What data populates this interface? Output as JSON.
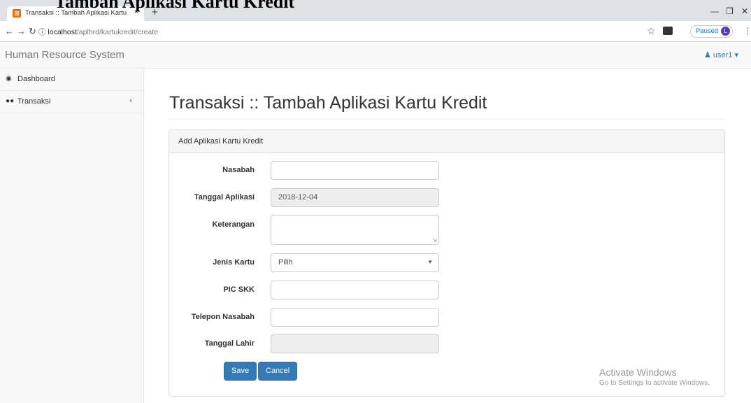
{
  "overlay_title": "Tambah Aplikasi Kartu Kredit",
  "browser": {
    "tab_title": "Transaksi :: Tambah Aplikasi Kartu",
    "tab_close": "×",
    "new_tab": "+",
    "url_host": "localhost",
    "url_path": "/aplhrd/kartukredit/create",
    "profile_status": "Paused",
    "profile_initial": "L"
  },
  "navbar": {
    "brand": "Human Resource System",
    "user": "user1"
  },
  "sidebar": {
    "items": [
      {
        "label": "Dashboard",
        "icon": "dashboard-icon"
      },
      {
        "label": "Transaksi",
        "icon": "users-icon",
        "chevron": "‹"
      }
    ]
  },
  "main": {
    "page_title": "Transaksi :: Tambah Aplikasi Kartu Kredit",
    "panel_heading": "Add Aplikasi Kartu Kredit",
    "fields": {
      "nasabah": {
        "label": "Nasabah",
        "value": ""
      },
      "tanggal_aplikasi": {
        "label": "Tanggal Aplikasi",
        "value": "2018-12-04"
      },
      "keterangan": {
        "label": "Keterangan",
        "value": ""
      },
      "jenis_kartu": {
        "label": "Jenis Kartu",
        "selected": "Pilih"
      },
      "pic_skk": {
        "label": "PIC SKK",
        "value": ""
      },
      "telepon_nasabah": {
        "label": "Telepon Nasabah",
        "value": ""
      },
      "tanggal_lahir": {
        "label": "Tanggal Lahir",
        "value": ""
      }
    },
    "save_label": "Save",
    "cancel_label": "Cancel"
  },
  "watermark": {
    "line1": "Activate Windows",
    "line2": "Go to Settings to activate Windows."
  },
  "colors": {
    "primary": "#337ab7",
    "navbar_bg": "#f8f8f8",
    "readonly_bg": "#eeeeee"
  }
}
